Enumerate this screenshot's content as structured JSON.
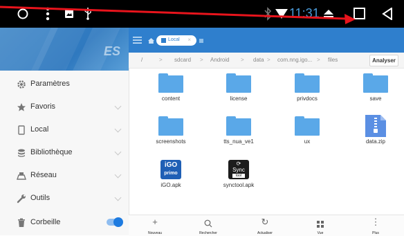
{
  "status_bar": {
    "time": "11:31",
    "icons": [
      "home-circle-icon",
      "more-vert-icon",
      "image-icon",
      "usb-icon",
      "bluetooth-icon",
      "wifi-icon",
      "eject-icon",
      "recents-icon",
      "back-icon"
    ]
  },
  "colors": {
    "accent": "#2f7fcd",
    "folder": "#5aa8e8",
    "annotation": "#e8141c"
  },
  "header": {
    "logo": "ES"
  },
  "sidebar": {
    "items": [
      {
        "label": "Paramètres",
        "icon": "gear-icon"
      },
      {
        "label": "Favoris",
        "icon": "star-icon"
      },
      {
        "label": "Local",
        "icon": "phone-icon"
      },
      {
        "label": "Bibliothèque",
        "icon": "library-icon"
      },
      {
        "label": "Réseau",
        "icon": "network-icon"
      },
      {
        "label": "Outils",
        "icon": "wrench-icon"
      },
      {
        "label": "Corbeille",
        "icon": "trash-icon",
        "toggle": "on"
      }
    ]
  },
  "tabbar": {
    "active_tab": "Local"
  },
  "path": {
    "segments": [
      "/",
      "sdcard",
      "Android",
      "data",
      "com.nng.igo...",
      "files"
    ],
    "action": "Analyser"
  },
  "files": [
    {
      "name": "content",
      "type": "folder"
    },
    {
      "name": "license",
      "type": "folder"
    },
    {
      "name": "privdocs",
      "type": "folder"
    },
    {
      "name": "save",
      "type": "folder"
    },
    {
      "name": "screenshots",
      "type": "folder"
    },
    {
      "name": "tts_nua_ve1",
      "type": "folder"
    },
    {
      "name": "ux",
      "type": "folder"
    },
    {
      "name": "data.zip",
      "type": "zip"
    },
    {
      "name": "iGO.apk",
      "type": "apk",
      "icon_text": [
        "iGO",
        "primo"
      ]
    },
    {
      "name": "synctool.apk",
      "type": "apk",
      "icon_text": [
        "Sync",
        "tool"
      ]
    }
  ],
  "bottombar": {
    "items": [
      {
        "label": "Nouveau",
        "icon": "plus-icon"
      },
      {
        "label": "Rechercher",
        "icon": "search-icon"
      },
      {
        "label": "Actualiser",
        "icon": "refresh-icon"
      },
      {
        "label": "Vue",
        "icon": "grid-view-icon"
      },
      {
        "label": "Plus",
        "icon": "more-icon"
      }
    ]
  }
}
